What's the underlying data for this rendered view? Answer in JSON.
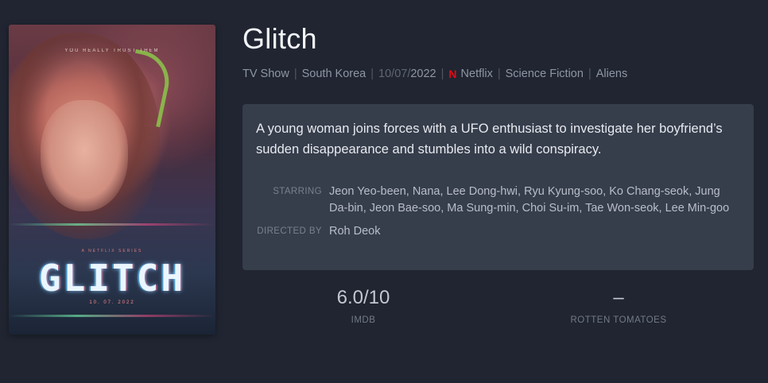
{
  "show": {
    "title": "Glitch",
    "meta": {
      "type": "TV Show",
      "country": "South Korea",
      "date_day_month": "10/07/",
      "date_year": "2022",
      "network_logo": "N",
      "network": "Netflix",
      "genre1": "Science Fiction",
      "genre2": "Aliens"
    },
    "synopsis": "A young woman joins forces with a UFO enthusiast to investigate her boyfriend’s sudden disappearance and stumbles into a wild conspiracy.",
    "credits": {
      "starring_label": "STARRING",
      "starring": "Jeon Yeo-been, Nana, Lee Dong-hwi, Ryu Kyung-soo, Ko Chang-seok, Jung Da-bin, Jeon Bae-soo, Ma Sung-min, Choi Su-im, Tae Won-seok, Lee Min-goo",
      "directed_label": "DIRECTED BY",
      "directed": "Roh Deok"
    },
    "ratings": {
      "imdb_score": "6.0/10",
      "imdb_label": "IMDB",
      "rt_score": "–",
      "rt_label": "ROTTEN TOMATOES"
    },
    "poster": {
      "tagline": "YOU REALLY TRUST THEM",
      "subtitle": "A NETFLIX SERIES",
      "logo": "GLITCH",
      "date": "10. 07. 2022"
    }
  },
  "colors": {
    "background": "#202531",
    "card": "#363d4b",
    "netflix_red": "#e50914"
  }
}
